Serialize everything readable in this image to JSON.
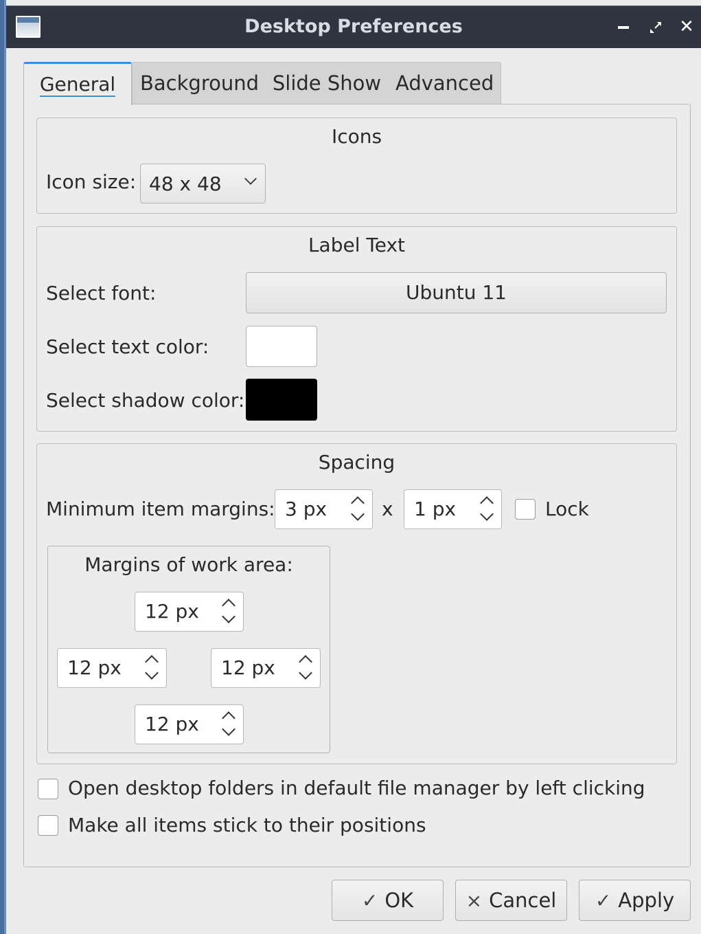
{
  "window": {
    "title": "Desktop Preferences",
    "icons": {
      "app": "window-app-icon",
      "minimize": "minimize-icon",
      "maximize": "maximize-icon",
      "close": "close-icon"
    }
  },
  "tabs": [
    {
      "label": "General",
      "active": true
    },
    {
      "label": "Background",
      "active": false
    },
    {
      "label": "Slide Show",
      "active": false
    },
    {
      "label": "Advanced",
      "active": false
    }
  ],
  "icons_group": {
    "title": "Icons",
    "icon_size_label": "Icon size:",
    "icon_size_value": "48 x 48"
  },
  "label_text_group": {
    "title": "Label Text",
    "font_label": "Select font:",
    "font_value": "Ubuntu 11",
    "text_color_label": "Select text color:",
    "text_color": "#ffffff",
    "shadow_color_label": "Select shadow color:",
    "shadow_color": "#000000"
  },
  "spacing_group": {
    "title": "Spacing",
    "min_margins_label": "Minimum item margins:",
    "margin_x": "3 px",
    "separator": "x",
    "margin_y": "1 px",
    "lock_label": "Lock",
    "lock_checked": false,
    "work_area": {
      "title": "Margins of work area:",
      "top": "12 px",
      "left": "12 px",
      "right": "12 px",
      "bottom": "12 px"
    }
  },
  "options": [
    {
      "label": "Open desktop folders in default file manager by left clicking",
      "checked": false
    },
    {
      "label": "Make all items stick to their positions",
      "checked": false
    }
  ],
  "buttons": {
    "ok": {
      "label": "OK",
      "icon": "check-icon",
      "glyph": "✓"
    },
    "cancel": {
      "label": "Cancel",
      "icon": "x-icon",
      "glyph": "×"
    },
    "apply": {
      "label": "Apply",
      "icon": "check-icon",
      "glyph": "✓"
    }
  },
  "colors": {
    "titlebar": "#2f3440",
    "accent": "#3d8ed8",
    "frame": "#4a6fa0"
  }
}
